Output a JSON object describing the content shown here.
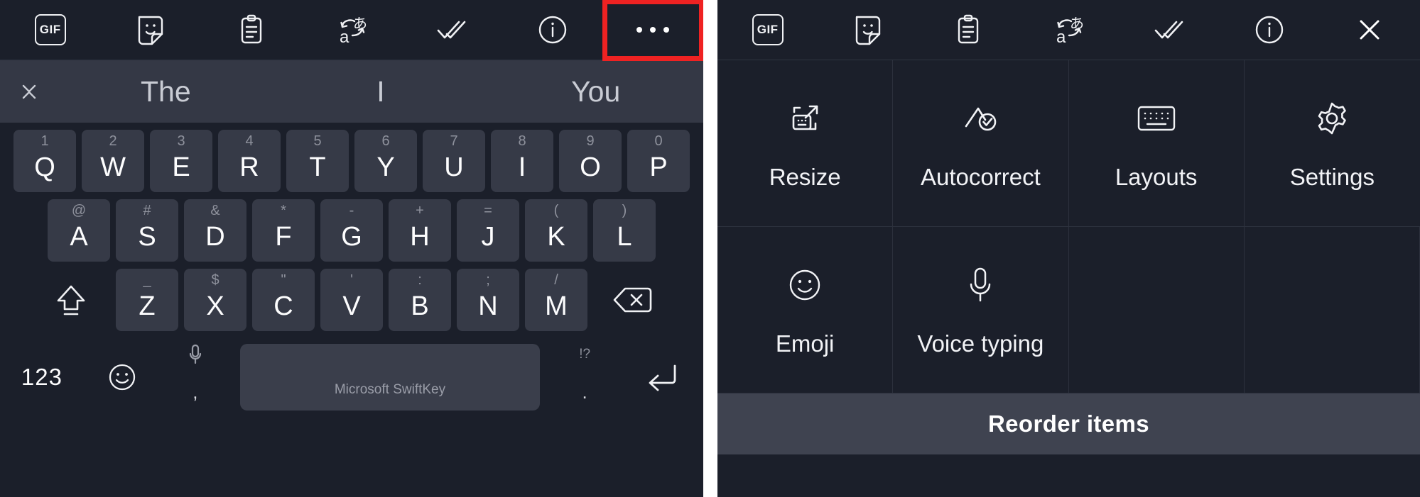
{
  "app": {
    "name": "Microsoft SwiftKey Keyboard",
    "theme_bg": "#1b1f2a",
    "key_bg": "#363a47",
    "accent_highlight": "#ef2222"
  },
  "left_panel": {
    "toolbar": {
      "items": [
        {
          "name": "gif-icon",
          "label": "GIF"
        },
        {
          "name": "sticker-icon",
          "label": "Stickers"
        },
        {
          "name": "clipboard-icon",
          "label": "Clipboard"
        },
        {
          "name": "translator-icon",
          "label": "Translator"
        },
        {
          "name": "tasks-icon",
          "label": "Tasks"
        },
        {
          "name": "info-icon",
          "label": "Info"
        },
        {
          "name": "more-icon",
          "label": "More"
        }
      ],
      "highlighted_item": "more-icon"
    },
    "suggestion_bar": {
      "close_label": "Close predictions",
      "suggestions": [
        "The",
        "I",
        "You"
      ]
    },
    "keyboard": {
      "row1": [
        {
          "main": "Q",
          "sec": "1"
        },
        {
          "main": "W",
          "sec": "2"
        },
        {
          "main": "E",
          "sec": "3"
        },
        {
          "main": "R",
          "sec": "4"
        },
        {
          "main": "T",
          "sec": "5"
        },
        {
          "main": "Y",
          "sec": "6"
        },
        {
          "main": "U",
          "sec": "7"
        },
        {
          "main": "I",
          "sec": "8"
        },
        {
          "main": "O",
          "sec": "9"
        },
        {
          "main": "P",
          "sec": "0"
        }
      ],
      "row2": [
        {
          "main": "A",
          "sec": "@"
        },
        {
          "main": "S",
          "sec": "#"
        },
        {
          "main": "D",
          "sec": "&"
        },
        {
          "main": "F",
          "sec": "*"
        },
        {
          "main": "G",
          "sec": "-"
        },
        {
          "main": "H",
          "sec": "+"
        },
        {
          "main": "J",
          "sec": "="
        },
        {
          "main": "K",
          "sec": "("
        },
        {
          "main": "L",
          "sec": ")"
        }
      ],
      "row3": [
        {
          "main": "Z",
          "sec": "_"
        },
        {
          "main": "X",
          "sec": "$"
        },
        {
          "main": "C",
          "sec": "\""
        },
        {
          "main": "V",
          "sec": "'"
        },
        {
          "main": "B",
          "sec": ":"
        },
        {
          "main": "N",
          "sec": ";"
        },
        {
          "main": "M",
          "sec": "/"
        }
      ],
      "shift_label": "Shift",
      "backspace_label": "Backspace",
      "bottom_row": {
        "numeric_label": "123",
        "emoji_label": "Emoji",
        "comma_top": "mic",
        "comma_bottom": ",",
        "space_label": "Microsoft SwiftKey",
        "period_top": "!?",
        "period_bottom": ".",
        "enter_label": "Enter"
      }
    }
  },
  "right_panel": {
    "toolbar": {
      "items": [
        {
          "name": "gif-icon",
          "label": "GIF"
        },
        {
          "name": "sticker-icon",
          "label": "Stickers"
        },
        {
          "name": "clipboard-icon",
          "label": "Clipboard"
        },
        {
          "name": "translator-icon",
          "label": "Translator"
        },
        {
          "name": "tasks-icon",
          "label": "Tasks"
        },
        {
          "name": "info-icon",
          "label": "Info"
        },
        {
          "name": "close-icon",
          "label": "Close"
        }
      ]
    },
    "menu": {
      "items": [
        {
          "icon": "resize-icon",
          "label": "Resize"
        },
        {
          "icon": "autocorrect-icon",
          "label": "Autocorrect"
        },
        {
          "icon": "layouts-icon",
          "label": "Layouts"
        },
        {
          "icon": "settings-gear-icon",
          "label": "Settings"
        },
        {
          "icon": "emoji-smiley-icon",
          "label": "Emoji"
        },
        {
          "icon": "microphone-icon",
          "label": "Voice typing"
        },
        {
          "icon": "",
          "label": ""
        },
        {
          "icon": "",
          "label": ""
        }
      ]
    },
    "reorder_label": "Reorder items"
  }
}
